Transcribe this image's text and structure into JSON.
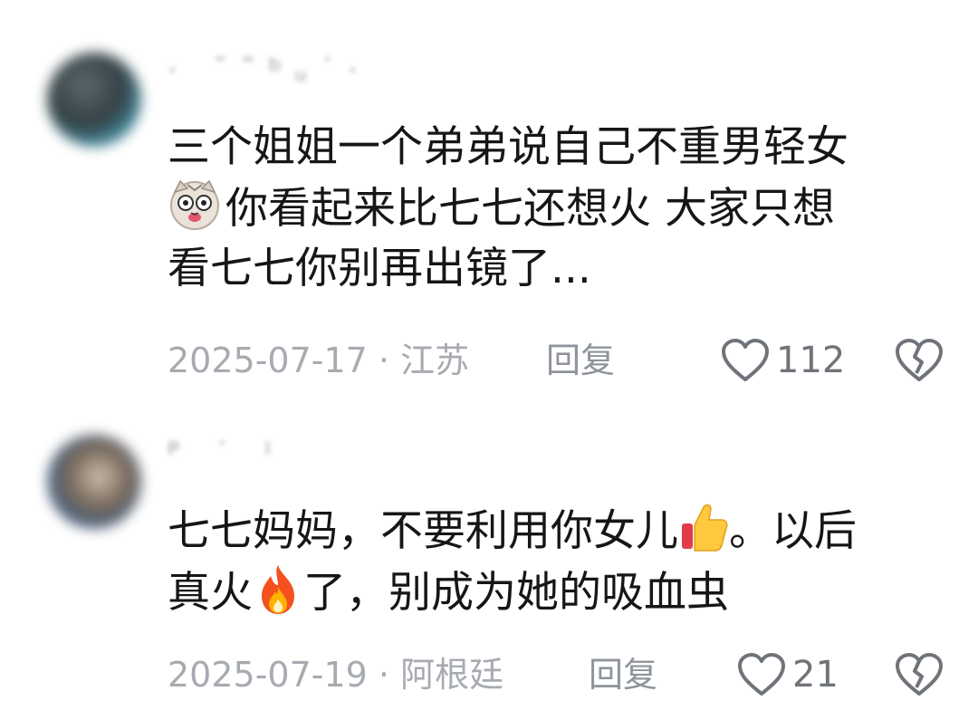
{
  "comments": [
    {
      "username": "· ˉ˜ᵇᵤ˙·",
      "text_line1": "三个姐姐一个弟弟说自己不重男轻女",
      "text_line2": "你看起来比七七还想火 大家只想",
      "text_line3": "看七七你别再出镜了...",
      "emoji": "cat-face-icon",
      "date": "2025-07-17",
      "location": "江苏",
      "reply_label": "回复",
      "like_count": "112"
    },
    {
      "username": "ᴾ ˙ ˡ",
      "text_line1a": "七七妈妈，不要利用你女儿",
      "text_line1b": "。以后",
      "text_line2a": "真火",
      "text_line2b": "了，别成为她的吸血虫",
      "date": "2025-07-19",
      "location": "阿根廷",
      "reply_label": "回复",
      "like_count": "21"
    }
  ],
  "separator": " · ",
  "colors": {
    "text": "#161616",
    "meta": "#a7abb1",
    "icon": "#6f747a"
  }
}
